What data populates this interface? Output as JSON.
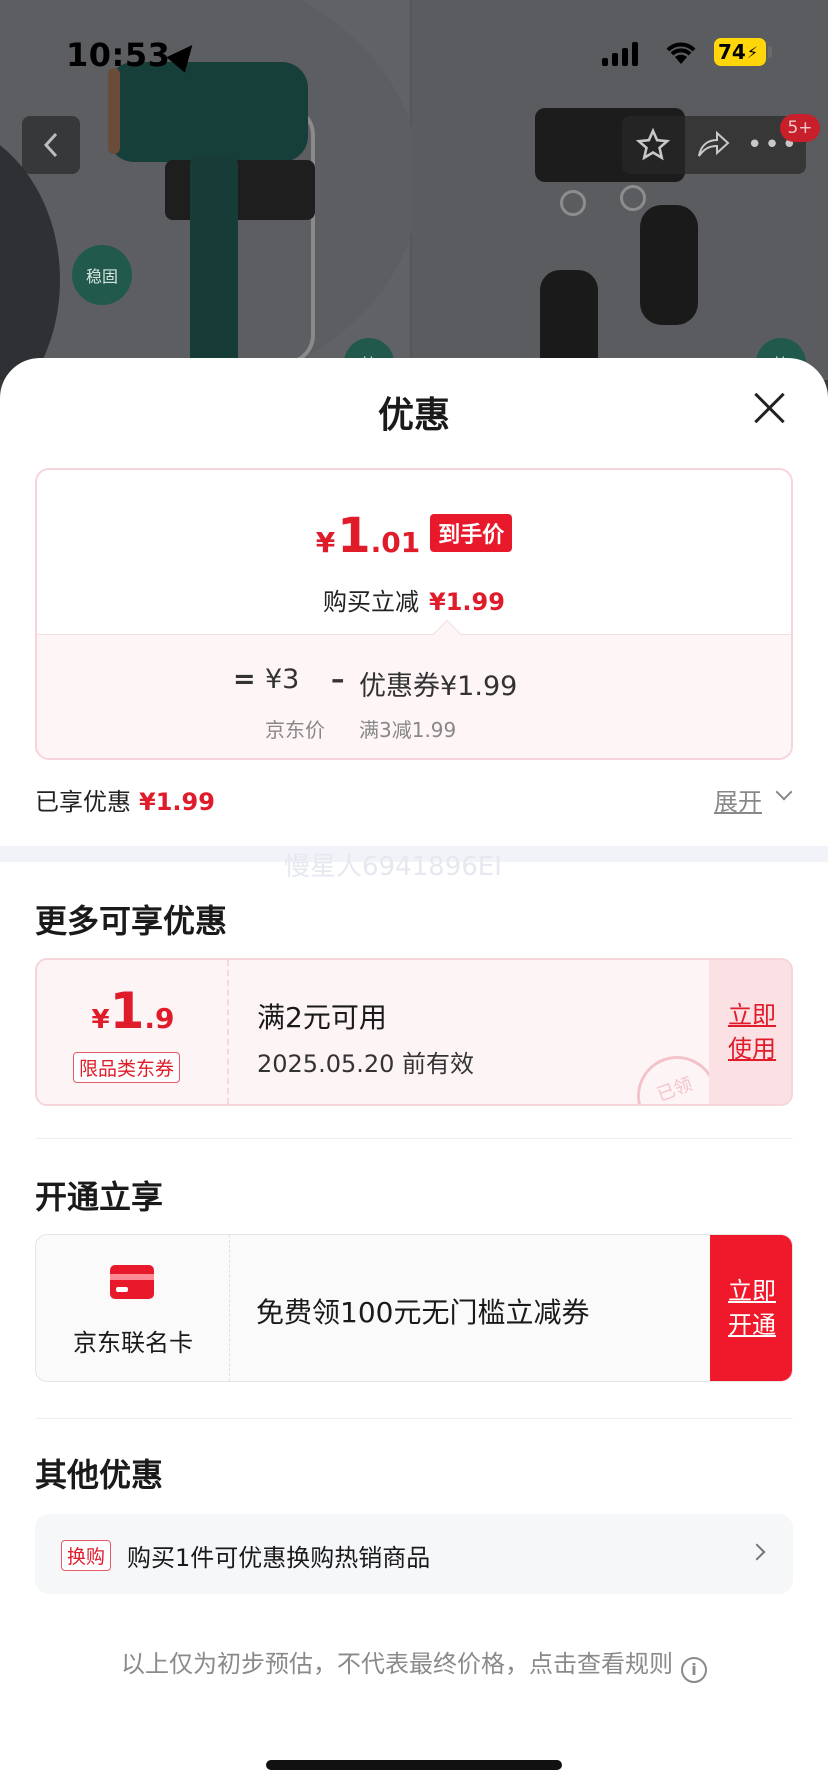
{
  "status_bar": {
    "time": "10:53",
    "battery": "74"
  },
  "background": {
    "bubble_left": "稳固",
    "bubble_mid": "挂",
    "bubble_right": "挂",
    "cart_badge": "5+"
  },
  "sheet": {
    "title": "优惠",
    "price": {
      "currency": "¥",
      "integer": "1",
      "decimal": ".01",
      "tag": "到手价",
      "reduce_label": "购买立减",
      "reduce_value": "¥1.99",
      "eq_sign": "=",
      "jd_price": "¥3",
      "minus_sign": "–",
      "coupon_text": "优惠券¥1.99",
      "jd_price_label": "京东价",
      "coupon_rule": "满3减1.99"
    },
    "enjoyed_label": "已享优惠",
    "enjoyed_value": "¥1.99",
    "expand_label": "展开",
    "watermark": "慢星人6941896EI"
  },
  "more_offers": {
    "title": "更多可享优惠",
    "coupon": {
      "currency": "¥",
      "integer": "1",
      "decimal": ".9",
      "type": "限品类东券",
      "condition": "满2元可用",
      "expiry": "2025.05.20 前有效",
      "stamp": "已领",
      "button": "立即使用"
    }
  },
  "open_offers": {
    "title": "开通立享",
    "card_name": "京东联名卡",
    "description": "免费领100元无门槛立减券",
    "button": "立即开通"
  },
  "other_offers": {
    "title": "其他优惠",
    "tag": "换购",
    "text": "购买1件可优惠换购热销商品"
  },
  "disclaimer": "以上仅为初步预估，不代表最终价格，点击查看规则",
  "colors": {
    "accent_red": "#e01b2a",
    "button_red": "#f0192b"
  }
}
